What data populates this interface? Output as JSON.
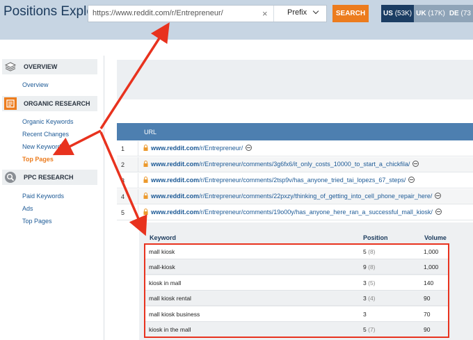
{
  "header": {
    "app_title": "Positions Explorer",
    "search_value": "https://www.reddit.com/r/Entrepreneur/",
    "clear_symbol": "×",
    "mode_label": "Prefix",
    "search_button": "SEARCH",
    "databases": [
      {
        "code": "US",
        "count": "(53K)",
        "active": true
      },
      {
        "code": "UK",
        "count": "(17K)",
        "active": false
      },
      {
        "code": "DE",
        "count": "(73",
        "active": false
      }
    ]
  },
  "sidebar": {
    "sections": [
      {
        "title": "OVERVIEW",
        "icon": "layers-icon",
        "items": [
          {
            "label": "Overview",
            "active": false
          }
        ]
      },
      {
        "title": "ORGANIC RESEARCH",
        "icon": "organic-research-icon",
        "items": [
          {
            "label": "Organic Keywords",
            "active": false
          },
          {
            "label": "Recent Changes",
            "active": false
          },
          {
            "label": "New Keywords",
            "active": false
          },
          {
            "label": "Top Pages",
            "active": true
          }
        ]
      },
      {
        "title": "PPC RESEARCH",
        "icon": "magnifier-icon",
        "items": [
          {
            "label": "Paid Keywords",
            "active": false
          },
          {
            "label": "Ads",
            "active": false
          },
          {
            "label": "Top Pages",
            "active": false
          }
        ]
      }
    ]
  },
  "url_table": {
    "header": "URL",
    "rows": [
      {
        "num": "1",
        "domain": "www.reddit.com",
        "path": "/r/Entrepreneur/"
      },
      {
        "num": "2",
        "domain": "www.reddit.com",
        "path": "/r/Entrepreneur/comments/3g6fx6/it_only_costs_10000_to_start_a_chickfila/"
      },
      {
        "num": "3",
        "domain": "www.reddit.com",
        "path": "/r/Entrepreneur/comments/2tsp9v/has_anyone_tried_tai_lopezs_67_steps/"
      },
      {
        "num": "4",
        "domain": "www.reddit.com",
        "path": "/r/Entrepreneur/comments/22pxzy/thinking_of_getting_into_cell_phone_repair_here/"
      },
      {
        "num": "5",
        "domain": "www.reddit.com",
        "path": "/r/Entrepreneur/comments/19o00y/has_anyone_here_ran_a_successful_mall_kiosk/"
      }
    ]
  },
  "keyword_table": {
    "headers": {
      "keyword": "Keyword",
      "position": "Position",
      "volume": "Volume"
    },
    "rows": [
      {
        "keyword": "mall kiosk",
        "position": "5",
        "prev": "(8)",
        "volume": "1,000"
      },
      {
        "keyword": "mall-kiosk",
        "position": "9",
        "prev": "(8)",
        "volume": "1,000"
      },
      {
        "keyword": "kiosk in mall",
        "position": "3",
        "prev": "(5)",
        "volume": "140"
      },
      {
        "keyword": "mall kiosk rental",
        "position": "3",
        "prev": "(4)",
        "volume": "90"
      },
      {
        "keyword": "mall kiosk business",
        "position": "3",
        "prev": "",
        "volume": "70"
      },
      {
        "keyword": "kiosk in the mall",
        "position": "5",
        "prev": "(7)",
        "volume": "90"
      }
    ]
  },
  "colors": {
    "accent": "#ec7c1e",
    "header_bg": "#c7d5e3",
    "table_header": "#4d7fb0",
    "annotation": "#e8321e",
    "link": "#1d5a96"
  }
}
